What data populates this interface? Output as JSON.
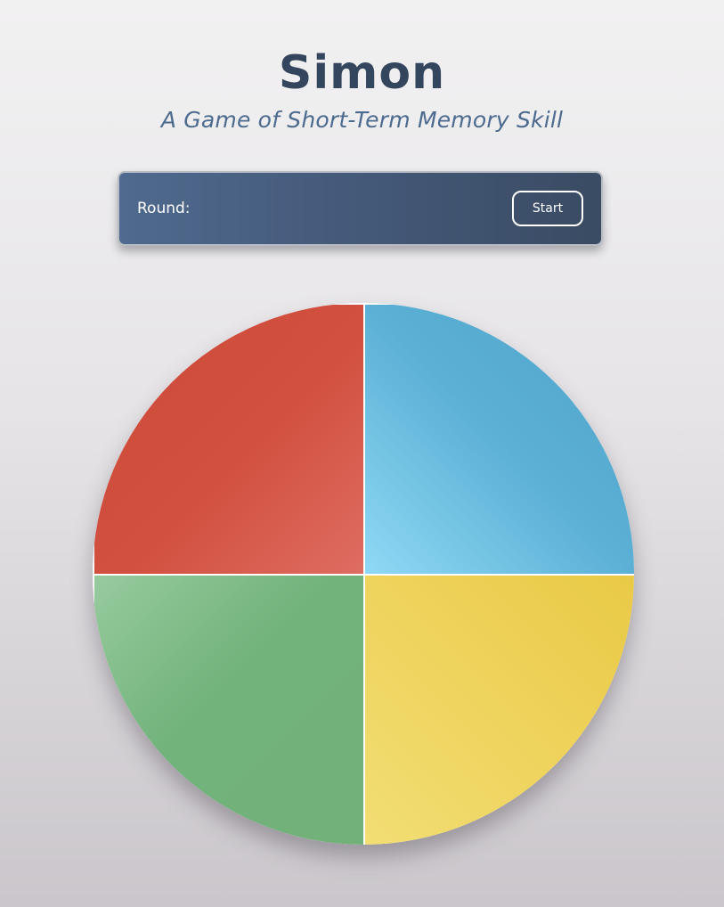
{
  "header": {
    "title": "Simon",
    "subtitle": "A Game of Short-Term Memory Skill"
  },
  "controls": {
    "round_label": "Round:",
    "round_value": "",
    "start_label": "Start"
  },
  "board": {
    "pads": [
      {
        "id": "red",
        "color": "#d2503f"
      },
      {
        "id": "blue",
        "color": "#5cb0d5"
      },
      {
        "id": "green",
        "color": "#72b27b"
      },
      {
        "id": "yellow",
        "color": "#eed25a"
      }
    ]
  },
  "colors": {
    "title": "#34455e",
    "subtitle": "#4d6b8e",
    "control_bar": "#465c7d"
  }
}
